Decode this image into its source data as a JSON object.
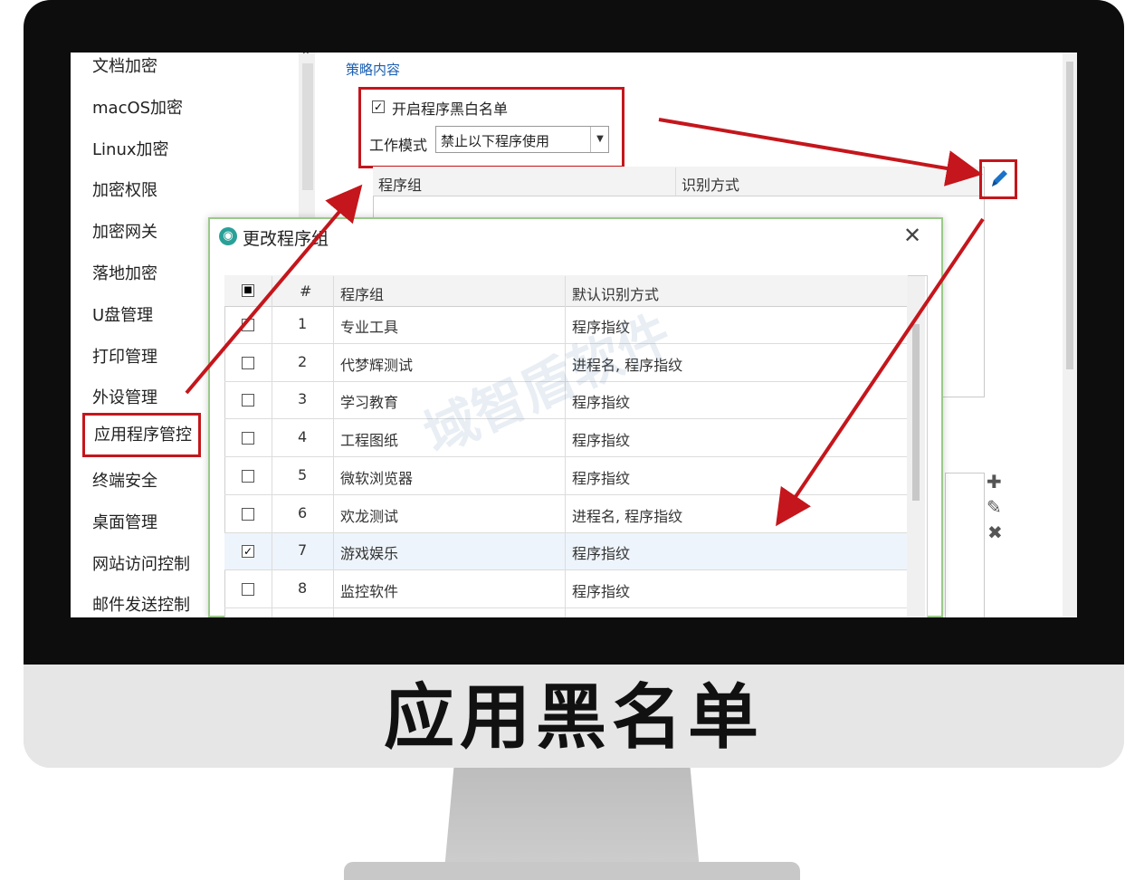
{
  "caption": "应用黑名单",
  "sidebar": {
    "items": [
      {
        "label": "文档加密",
        "name": "sidebar-item-document-encryption"
      },
      {
        "label": "macOS加密",
        "name": "sidebar-item-macos-encryption"
      },
      {
        "label": "Linux加密",
        "name": "sidebar-item-linux-encryption"
      },
      {
        "label": "加密权限",
        "name": "sidebar-item-encryption-permissions"
      },
      {
        "label": "加密网关",
        "name": "sidebar-item-encryption-gateway"
      },
      {
        "label": "落地加密",
        "name": "sidebar-item-landing-encryption"
      },
      {
        "label": "U盘管理",
        "name": "sidebar-item-usb-management"
      },
      {
        "label": "打印管理",
        "name": "sidebar-item-print-management"
      },
      {
        "label": "外设管理",
        "name": "sidebar-item-peripheral-management"
      },
      {
        "label": "应用程序管控",
        "name": "sidebar-item-application-control",
        "active": true
      },
      {
        "label": "终端安全",
        "name": "sidebar-item-endpoint-security"
      },
      {
        "label": "桌面管理",
        "name": "sidebar-item-desktop-management"
      },
      {
        "label": "网站访问控制",
        "name": "sidebar-item-website-access-control"
      },
      {
        "label": "邮件发送控制",
        "name": "sidebar-item-email-sending-control"
      }
    ]
  },
  "policy": {
    "section_label": "策略内容",
    "enable_checkbox_label": "开启程序黑白名单",
    "enable_checked": true,
    "work_mode_label": "工作模式",
    "work_mode_value": "禁止以下程序使用",
    "table_headers": [
      "程序组",
      "识别方式"
    ]
  },
  "dialog": {
    "title": "更改程序组",
    "headers": {
      "index": "#",
      "group": "程序组",
      "method": "默认识别方式"
    },
    "rows": [
      {
        "index": "1",
        "group": "专业工具",
        "method": "程序指纹",
        "checked": false
      },
      {
        "index": "2",
        "group": "代梦辉测试",
        "method": "进程名, 程序指纹",
        "checked": false
      },
      {
        "index": "3",
        "group": "学习教育",
        "method": "程序指纹",
        "checked": false
      },
      {
        "index": "4",
        "group": "工程图纸",
        "method": "程序指纹",
        "checked": false
      },
      {
        "index": "5",
        "group": "微软浏览器",
        "method": "程序指纹",
        "checked": false
      },
      {
        "index": "6",
        "group": "欢龙测试",
        "method": "进程名, 程序指纹",
        "checked": false
      },
      {
        "index": "7",
        "group": "游戏娱乐",
        "method": "程序指纹",
        "checked": true
      },
      {
        "index": "8",
        "group": "监控软件",
        "method": "程序指纹",
        "checked": false
      }
    ]
  },
  "watermark": "域智盾软件",
  "icons": {
    "edit": "pencil-icon",
    "add": "plus-icon",
    "remove": "x-icon",
    "close": "close-icon",
    "dropdown": "triangle-down-icon"
  },
  "colors": {
    "highlight_red": "#c4161c",
    "link_blue": "#1a5fb4",
    "dialog_border": "#9bc98a",
    "dialog_icon": "#2aa198"
  }
}
